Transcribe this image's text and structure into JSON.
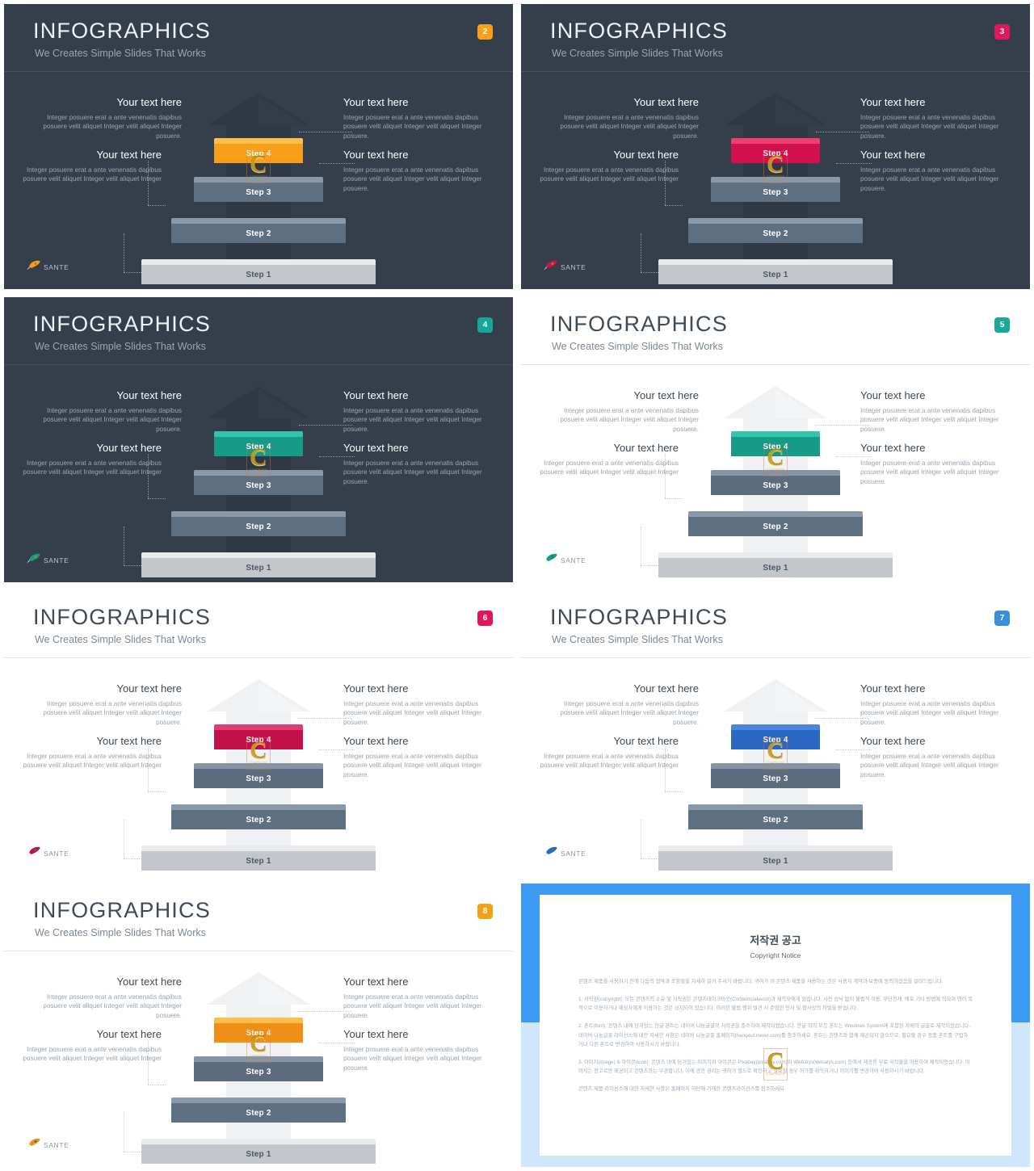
{
  "common": {
    "title": "INFOGRAPHICS",
    "subtitle": "We Creates Simple Slides That Works",
    "logo_name": "SANTE",
    "logo_icon": "rocket-icon",
    "watermark_letter": "C",
    "watermark_caption": "CONTENTS",
    "steps": [
      {
        "label": "Step 1"
      },
      {
        "label": "Step 2"
      },
      {
        "label": "Step 3"
      },
      {
        "label": "Step 4"
      }
    ],
    "callouts": [
      {
        "heading": "Your text here",
        "body": "Integer posuere erat a ante venenatis dapibus posuere velit aliquet Integer velit aliquet Integer posuere."
      },
      {
        "heading": "Your text here",
        "body": "Integer posuere erat a ante venenatis dapibus posuere velit aliquet Integer velit aliquet Integer posuere."
      },
      {
        "heading": "Your text here",
        "body": "Integer posuere erat a ante venenatis dapibus posuere velit aliquet Integer velit aliquet Integer"
      },
      {
        "heading": "Your text here",
        "body": "Integer posuere erat a ante venenatis dapibus posuere velit aliquet Integer velit aliquet Integer posuere."
      }
    ]
  },
  "slides": [
    {
      "number": "2",
      "theme": "dark",
      "badge_color": "#f5a018",
      "accent": "#f5a018",
      "accent_top": "#fcbf4d"
    },
    {
      "number": "3",
      "theme": "dark",
      "badge_color": "#e2175b",
      "accent": "#d2104e",
      "accent_top": "#ef3f74"
    },
    {
      "number": "4",
      "theme": "dark",
      "badge_color": "#17a79a",
      "accent": "#179b88",
      "accent_top": "#36c3ab"
    },
    {
      "number": "5",
      "theme": "light",
      "badge_color": "#1aa899",
      "accent": "#179b88",
      "accent_top": "#36c3ab"
    },
    {
      "number": "6",
      "theme": "light",
      "badge_color": "#e2175b",
      "accent": "#c3104a",
      "accent_top": "#e23c6e"
    },
    {
      "number": "7",
      "theme": "light",
      "badge_color": "#3a8ede",
      "accent": "#2a66c4",
      "accent_top": "#4a86e0"
    },
    {
      "number": "8",
      "theme": "light",
      "badge_color": "#f5a018",
      "accent": "#ef8f16",
      "accent_top": "#fcbf4d"
    }
  ],
  "copyright": {
    "title_ko": "저작권 공고",
    "title_en": "Copyright Notice",
    "paragraphs": [
      "콘텐츠 제품을 사용하기 전에 다음의 협약과 조항들을 자세히 읽어 주시기 바랍니다. 귀하가 이 콘텐츠 제품을 사용하는 것은 사용자 계약과 보증에 동의하셨음을 알려드립니다.",
      "1. 저작권(copyright): 모든 콘텐츠의 소유 및 저작권은 콘텐츠테이크아웃(Contentstakeout)과 제작자에게 있습니다. 사전 승낙 없이 불법적 이용, 무단전재, 배포 기타 방법에 의하여 영리 목적으로 이용하거나 제삼자에게 이용하는 것은 금지되어 있습니다. 이러한 불법 행위 발견 시 준엄한 민사 및 형사상의 처벌을 받습니다.",
      "2. 폰트(font): 콘텐츠 내에 담겨있는 한글 폰트는 네이버 나눔글꼴의 저작권을 준수하여 제작되었습니다. 한글 외의 모든 폰트는 Windows System에 포함된 자체의 글꼴로 제작되었습니다. 네이버 나눔글꼴 라이선스에 대한 자세한 사항은 네이버 나눔글꼴 홈페이지(hangeul.naver.com)를 참조하세요. 폰트는 콘텐츠와 함께 제공되지 않으므로, 필요할 경우 정품 폰트를 구입하거나 다른 폰트로 변경하여 사용하시기 바랍니다.",
      "3. 이미지(image) & 아이콘(icon): 콘텐츠 내에 담겨있는 이미지와 아이콘은 Pixabay(pixabay.com)와 Webarys(webalys.com) 등에서 제공한 무료 저작물을 이용하여 제작되었습니다. 이미지는 참고로만 제공되고 콘텐츠와는 무관합니다. 이에 관한 권리는 귀하가 별도로 확인하고 필요할 경우 허가를 취득하거나 이미지를 변경하여 사용하시기 바랍니다.",
      "콘텐츠 제품 라이선스에 대한 자세한 사항은 홈페이지 하단에 기재한 콘텐츠라이선스를 참조하세요."
    ]
  }
}
